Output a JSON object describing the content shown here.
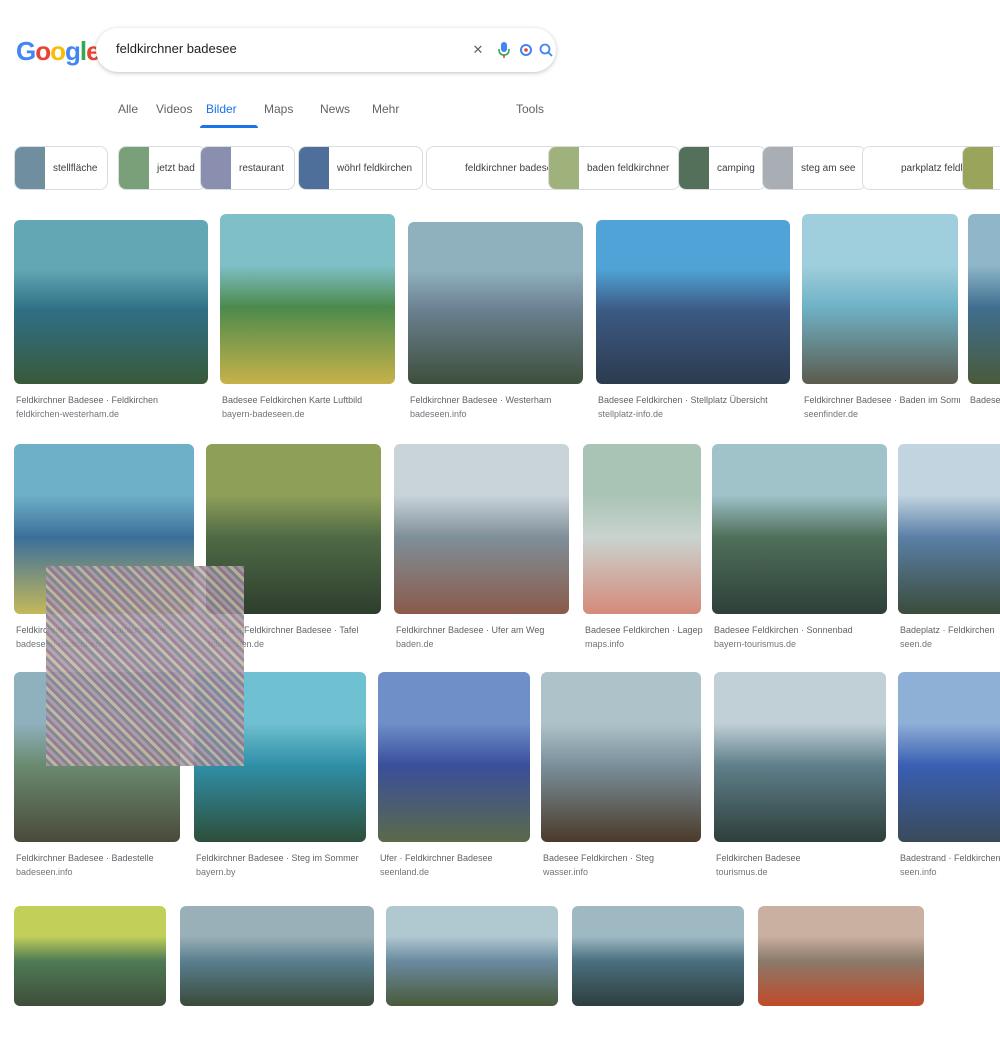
{
  "header": {
    "logo_letters": [
      {
        "ch": "G",
        "color": "#4285f4"
      },
      {
        "ch": "o",
        "color": "#ea4335"
      },
      {
        "ch": "o",
        "color": "#fbbc05"
      },
      {
        "ch": "g",
        "color": "#4285f4"
      },
      {
        "ch": "l",
        "color": "#34a853"
      },
      {
        "ch": "e",
        "color": "#ea4335"
      }
    ],
    "search_query": "feldkirchner badesee",
    "icons": [
      "close-icon",
      "mic-icon",
      "lens-icon",
      "search-icon"
    ]
  },
  "tabs": [
    {
      "label": "Alle",
      "active": false
    },
    {
      "label": "Videos",
      "active": false
    },
    {
      "label": "Bilder",
      "active": true
    },
    {
      "label": "Maps",
      "active": false
    },
    {
      "label": "News",
      "active": false
    },
    {
      "label": "Mehr",
      "active": false
    }
  ],
  "tools_label": "Tools",
  "chips": [
    {
      "label": "stellfläche",
      "color": "#6f8fa0"
    },
    {
      "label": "jetzt bad",
      "color": "#7aa07a"
    },
    {
      "label": "restaurant",
      "color": "#8a8fb0"
    },
    {
      "label": "wöhrl feldkirchen",
      "color": "#4d6f9a"
    },
    {
      "label": "feldkirchner badesee karte",
      "color": "#ffffff"
    },
    {
      "label": "baden feldkirchner",
      "color": "#9fb27c"
    },
    {
      "label": "camping",
      "color": "#55705a"
    },
    {
      "label": "steg am see",
      "color": "#a8aeb3"
    },
    {
      "label": "parkplatz feldkirchen",
      "color": "#ffffff"
    },
    {
      "label": "",
      "color": "#9aa45a"
    }
  ],
  "results": [
    {
      "caption": "Feldkirchner Badesee · Feldkirchen",
      "source": "feldkirchen-westerham.de",
      "colors": [
        "#2f6f86",
        "#62a7b3",
        "#385a3a"
      ]
    },
    {
      "caption": "Badesee Feldkirchen Karte Luftbild",
      "source": "bayern-badeseen.de",
      "colors": [
        "#4c8a4c",
        "#7fc0c8",
        "#c7b24a"
      ]
    },
    {
      "caption": "Feldkirchner Badesee · Westerham",
      "source": "badeseen.info",
      "colors": [
        "#6a7f8f",
        "#8fb0bd",
        "#3e4f3c"
      ]
    },
    {
      "caption": "Badesee Feldkirchen · Stellplatz Übersicht",
      "source": "stellplatz-info.de",
      "colors": [
        "#3c5a84",
        "#4fa3d6",
        "#2c3b4f"
      ]
    },
    {
      "caption": "Feldkirchner Badesee · Baden im Sommer",
      "source": "seenfinder.de",
      "colors": [
        "#6fb1c6",
        "#9fcfdc",
        "#5b5b4d"
      ]
    },
    {
      "caption": "Badesee",
      "source": "",
      "colors": [
        "#3f6f8f",
        "#8fb7c9",
        "#4a5a3a"
      ]
    },
    {
      "caption": "Feldkirchner Badesee · Luftaufnahme",
      "source": "badeseen-muenchen.de",
      "colors": [
        "#3a6f9a",
        "#6fb0c9",
        "#c5b85a"
      ]
    },
    {
      "caption": "Steg am Feldkirchner Badesee · Tafel",
      "source": "feldkirchen.de",
      "colors": [
        "#4f6a45",
        "#8e9f58",
        "#2e3e2e"
      ]
    },
    {
      "caption": "Feldkirchner Badesee · Ufer am Weg",
      "source": "baden.de",
      "colors": [
        "#7f8f99",
        "#c9d4d9",
        "#8a5a4a"
      ]
    },
    {
      "caption": "Badesee Feldkirchen · Lageplan",
      "source": "maps.info",
      "colors": [
        "#c9d3cf",
        "#a9c4b4",
        "#d58a7a"
      ]
    },
    {
      "caption": "Badesee Feldkirchen · Sonnenbad",
      "source": "bayern-tourismus.de",
      "colors": [
        "#4f6f5a",
        "#9fc3c9",
        "#2e3f3a"
      ]
    },
    {
      "caption": "Badeplatz · Feldkirchen",
      "source": "seen.de",
      "colors": [
        "#5a7fa6",
        "#c2d4e0",
        "#3b4c3b"
      ]
    },
    {
      "caption": "Feldkirchner Badesee · Badestelle",
      "source": "badeseen.info",
      "colors": [
        "#6a8a6f",
        "#8fb0bd",
        "#4a4a3a"
      ]
    },
    {
      "caption": "Feldkirchner Badesee · Steg im Sommer",
      "source": "bayern.by",
      "colors": [
        "#2f8fa6",
        "#6fc0d0",
        "#2e4e3a"
      ]
    },
    {
      "caption": "Ufer · Feldkirchner Badesee",
      "source": "seenland.de",
      "colors": [
        "#3a4f9a",
        "#6f8fc9",
        "#5a6a4a"
      ]
    },
    {
      "caption": "Badesee Feldkirchen · Steg",
      "source": "wasser.info",
      "colors": [
        "#7a8f9a",
        "#aec3c9",
        "#4b3a2a"
      ]
    },
    {
      "caption": "Feldkirchen Badesee",
      "source": "tourismus.de",
      "colors": [
        "#5f7f8a",
        "#c0d0d6",
        "#2e3e3a"
      ]
    },
    {
      "caption": "Badestrand · Feldkirchen",
      "source": "seen.info",
      "colors": [
        "#3a5fb3",
        "#8fb0d6",
        "#3a4a5a"
      ]
    },
    {
      "caption": "",
      "source": "",
      "colors": [
        "#4f7a55",
        "#c2d05a",
        "#3e4e3a"
      ]
    },
    {
      "caption": "",
      "source": "",
      "colors": [
        "#5a7f8f",
        "#9ab0b8",
        "#3a4a3a"
      ]
    },
    {
      "caption": "",
      "source": "",
      "colors": [
        "#6a8aa0",
        "#b0c9d0",
        "#4a5a3a"
      ]
    },
    {
      "caption": "",
      "source": "",
      "colors": [
        "#4a6f7f",
        "#9fb9c3",
        "#2e3e3e"
      ]
    },
    {
      "caption": "",
      "source": "",
      "colors": [
        "#8a7a6a",
        "#c9b0a0",
        "#c04a2a"
      ]
    }
  ]
}
